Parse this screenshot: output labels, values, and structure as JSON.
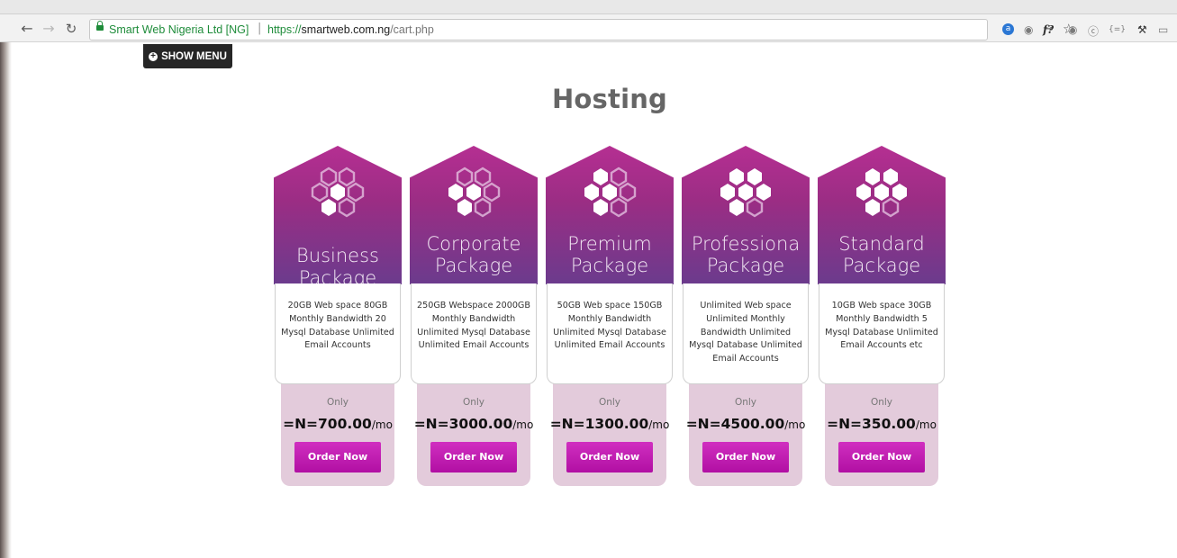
{
  "browser": {
    "site_name": "Smart Web Nigeria Ltd [NG]",
    "url_separator": "|",
    "url_scheme": "https://",
    "url_host": "smartweb.com.ng",
    "url_path": "/cart.php"
  },
  "page": {
    "show_menu_label": "SHOW MENU",
    "title": "Hosting"
  },
  "packages": [
    {
      "line1": "Business",
      "line2": "Package",
      "description": "20GB Web space 80GB Monthly Bandwidth 20 Mysql Database Unlimited Email Accounts",
      "only_label": "Only",
      "price": "=N=700.00",
      "period": "/mo",
      "button": "Order Now"
    },
    {
      "line1": "Corporate",
      "line2": "Package",
      "description": "250GB Webspace 2000GB Monthly Bandwidth Unlimited Mysql Database Unlimited Email Accounts",
      "only_label": "Only",
      "price": "=N=3000.00",
      "period": "/mo",
      "button": "Order Now"
    },
    {
      "line1": "Premium",
      "line2": "Package",
      "description": "50GB Web space 150GB Monthly Bandwidth Unlimited Mysql Database Unlimited Email Accounts",
      "only_label": "Only",
      "price": "=N=1300.00",
      "period": "/mo",
      "button": "Order Now"
    },
    {
      "line1": "Professiona",
      "line2": "Package",
      "description": "Unlimited Web space Unlimited Monthly Bandwidth Unlimited Mysql Database Unlimited Email Accounts",
      "only_label": "Only",
      "price": "=N=4500.00",
      "period": "/mo",
      "button": "Order Now"
    },
    {
      "line1": "Standard",
      "line2": "Package",
      "description": "10GB Web space 30GB Monthly Bandwidth 5 Mysql Database Unlimited Email Accounts etc",
      "only_label": "Only",
      "price": "=N=350.00",
      "period": "/mo",
      "button": "Order Now"
    }
  ],
  "icons": [
    "back-arrow-icon",
    "forward-arrow-icon",
    "reload-icon",
    "lock-icon",
    "key-icon",
    "star-icon",
    "plus-circle-icon",
    "hexagon-cluster-icon"
  ],
  "colors": {
    "accent": "#b10fa3",
    "header_purple": "#9b2d84",
    "price_box": "#e3cbdb",
    "secure_green": "#1e8c3a"
  }
}
